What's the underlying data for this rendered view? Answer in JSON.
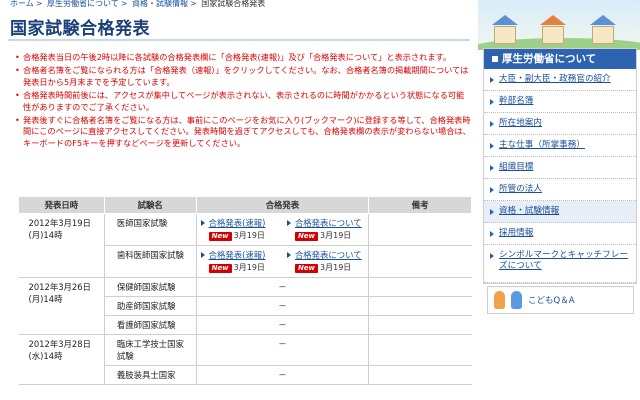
{
  "breadcrumb": {
    "items": [
      "ホーム",
      "厚生労働省について",
      "資格・試験情報",
      "国家試験合格発表"
    ],
    "sep": ">"
  },
  "page": {
    "title": "国家試験合格発表"
  },
  "notices": [
    "合格発表当日の午後2時以降に各試験の合格発表欄に「合格発表(速報)」及び「合格発表について」と表示されます。",
    "合格者名簿をご覧になられる方は「合格発表（速報）」をクリックしてください。なお、合格者名簿の掲載期間については発表日から5月末までを予定しています。",
    "合格発表時間前後には、アクセスが集中してページが表示されない、表示されるのに時間がかかるという状態になる可能性がありますのでご了承ください。",
    "発表後すぐに合格者名簿をご覧になる方は、事前にこのページをお気に入り(ブックマーク)に登録する等して、合格発表時間にこのページに直接アクセスしてください。発表時間を過ぎてアクセスしても、合格発表欄の表示が変わらない場合は、キーボードのF5キーを押すなどページを更新してください。"
  ],
  "table": {
    "headers": {
      "date": "発表日時",
      "exam": "試験名",
      "result": "合格発表",
      "note": "備考"
    },
    "new_badge": "New",
    "groups": [
      {
        "date": "2012年3月19日(月)14時",
        "rows": [
          {
            "exam": "医師国家試験",
            "link1": "合格発表(速報)",
            "date1": "3月19日",
            "link2": "合格発表について",
            "date2": "3月19日"
          },
          {
            "exam": "歯科医師国家試験",
            "link1": "合格発表(速報)",
            "date1": "3月19日",
            "link2": "合格発表について",
            "date2": "3月19日"
          }
        ]
      },
      {
        "date": "2012年3月26日(月)14時",
        "rows": [
          {
            "exam": "保健師国家試験",
            "dash": "－"
          },
          {
            "exam": "助産師国家試験",
            "dash": "－"
          },
          {
            "exam": "看護師国家試験",
            "dash": "－"
          }
        ]
      },
      {
        "date": "2012年3月28日(水)14時",
        "rows": [
          {
            "exam": "臨床工学技士国家試験",
            "dash": "－"
          },
          {
            "exam": "義肢装具士国家",
            "dash": "－"
          }
        ]
      }
    ]
  },
  "sidebar": {
    "header": "厚生労働省について",
    "items": [
      "大臣・副大臣・政務官の紹介",
      "幹部名簿",
      "所在地案内",
      "主な仕事（所掌事務）",
      "組織目標",
      "所管の法人",
      "資格・試験情報",
      "採用情報",
      "シンボルマークとキャッチフレーズについて"
    ],
    "active_index": 6
  },
  "kids_link": "こどもQ＆A",
  "colors": {
    "accent": "#2d63b0",
    "notice": "#e00000",
    "link": "#1a4f9c"
  }
}
